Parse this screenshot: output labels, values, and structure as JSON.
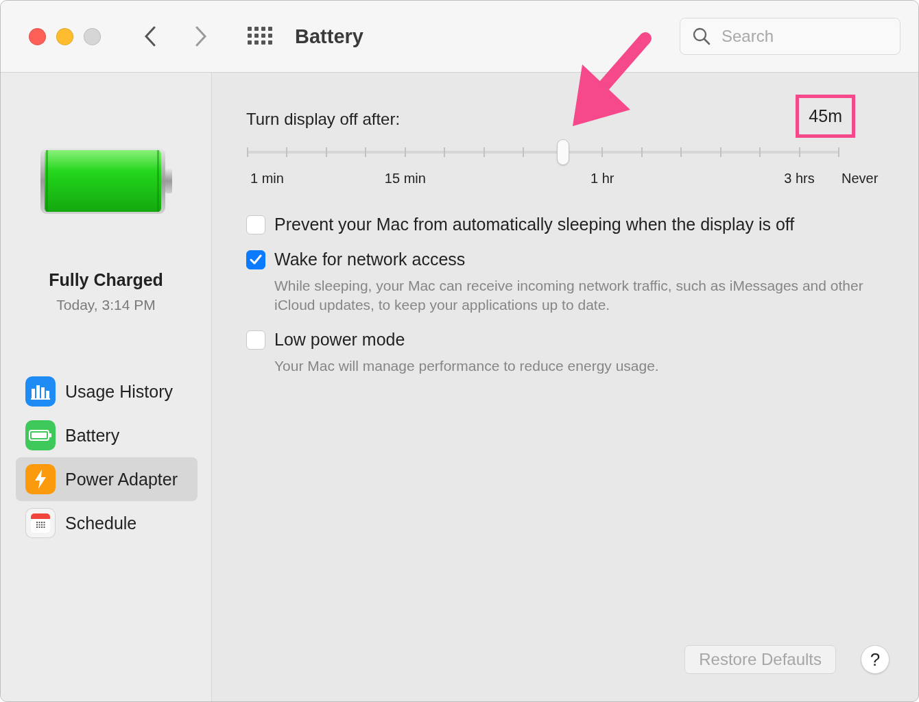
{
  "window": {
    "title": "Battery"
  },
  "search": {
    "placeholder": "Search"
  },
  "sidebar": {
    "status": "Fully Charged",
    "time": "Today, 3:14 PM",
    "items": [
      {
        "label": "Usage History",
        "kind": "usage",
        "selected": false
      },
      {
        "label": "Battery",
        "kind": "battery",
        "selected": false
      },
      {
        "label": "Power Adapter",
        "kind": "power",
        "selected": true
      },
      {
        "label": "Schedule",
        "kind": "schedule",
        "selected": false
      }
    ]
  },
  "display_slider": {
    "label": "Turn display off after:",
    "value": "45m",
    "level": 0.534,
    "ticks": [
      {
        "kind": "major",
        "label": "1 min"
      },
      {
        "kind": "minor"
      },
      {
        "kind": "minor"
      },
      {
        "kind": "minor"
      },
      {
        "kind": "major",
        "label": "15 min"
      },
      {
        "kind": "minor"
      },
      {
        "kind": "minor"
      },
      {
        "kind": "minor"
      },
      {
        "kind": "minor"
      },
      {
        "kind": "major",
        "label": "1 hr"
      },
      {
        "kind": "minor"
      },
      {
        "kind": "minor"
      },
      {
        "kind": "minor"
      },
      {
        "kind": "minor"
      },
      {
        "kind": "major",
        "label": "3 hrs"
      },
      {
        "kind": "major",
        "label": "Never"
      }
    ]
  },
  "options": [
    {
      "label": "Prevent your Mac from automatically sleeping when the display is off",
      "checked": false
    },
    {
      "label": "Wake for network access",
      "checked": true,
      "description": "While sleeping, your Mac can receive incoming network traffic, such as iMessages and other iCloud updates, to keep your applications up to date."
    },
    {
      "label": "Low power mode",
      "checked": false,
      "description": "Your Mac will manage performance to reduce energy usage."
    }
  ],
  "restore_button": {
    "label": "Restore Defaults",
    "disabled": true
  },
  "help_button": {
    "label": "?"
  }
}
